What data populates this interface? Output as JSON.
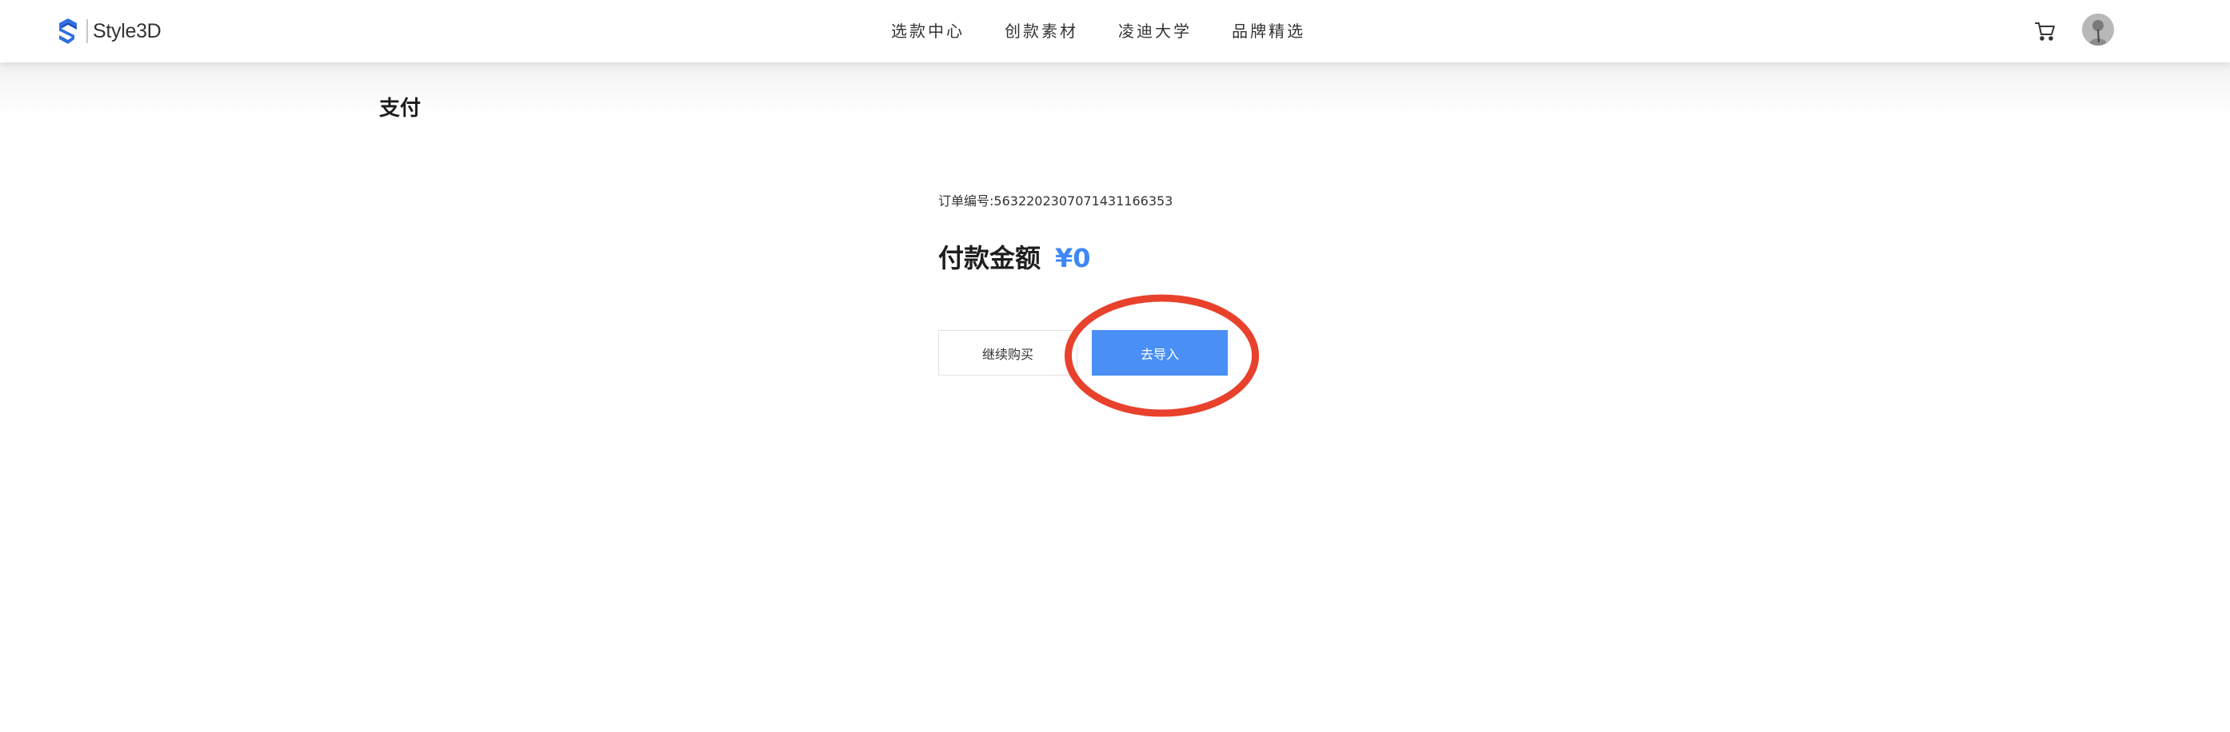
{
  "header": {
    "logo_text": "Style3D",
    "nav": [
      {
        "label": "选款中心"
      },
      {
        "label": "创款素材"
      },
      {
        "label": "凌迪大学"
      },
      {
        "label": "品牌精选"
      }
    ],
    "icons": {
      "cart": "cart-icon",
      "avatar": "user-avatar"
    }
  },
  "page": {
    "title": "支付"
  },
  "payment": {
    "order_label": "订单编号:",
    "order_number": "563220230707143116635​3",
    "amount_label": "付款金额",
    "amount_value": "¥0"
  },
  "actions": {
    "continue_label": "继续购买",
    "import_label": "去导入"
  },
  "colors": {
    "accent": "#4a8ff5",
    "amount": "#3f87f5",
    "annotation": "#e8412c"
  }
}
